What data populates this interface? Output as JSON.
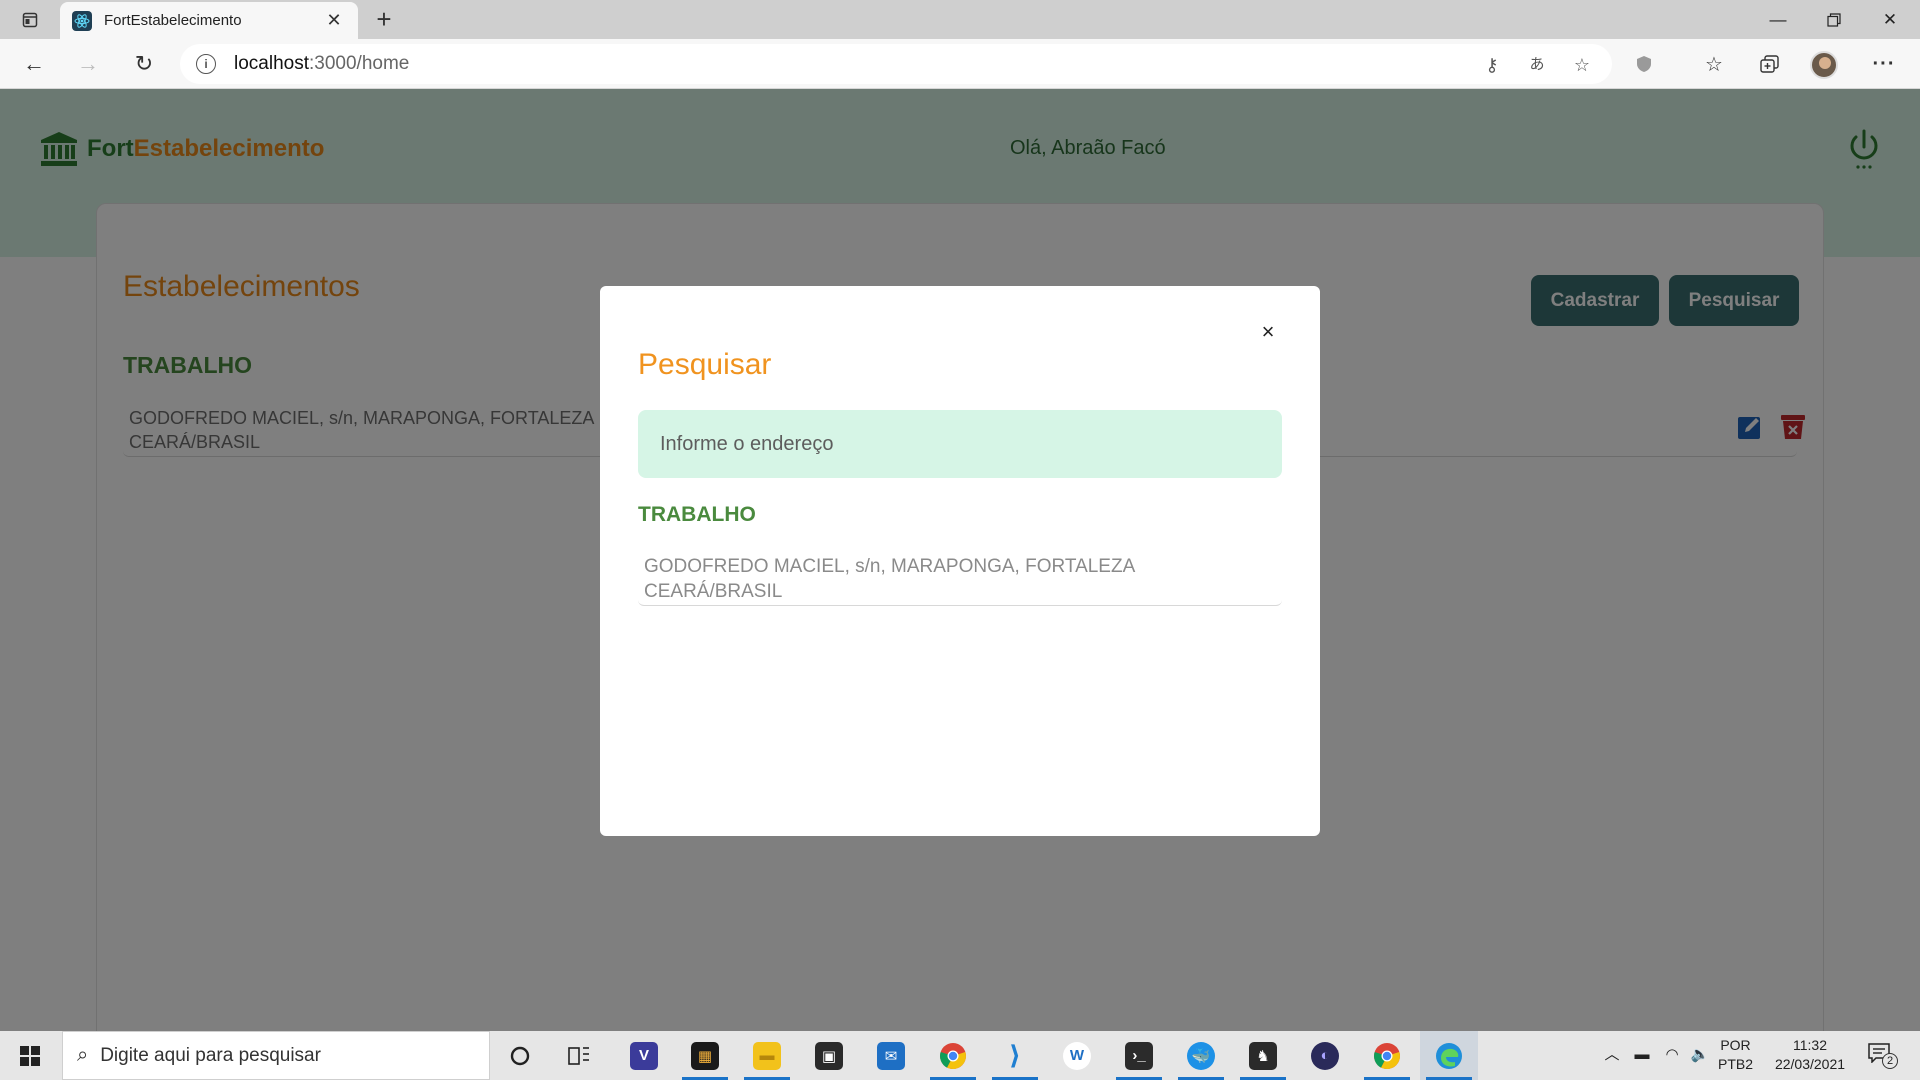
{
  "browser": {
    "tab_title": "FortEstabelecimento",
    "url_host": "localhost",
    "url_path": ":3000/home"
  },
  "app": {
    "logo_fort": "Fort",
    "logo_est": "Estabelecimento",
    "greeting": "Olá, Abraão Facó",
    "colors": {
      "header_bg": "#d6f2e4",
      "orange": "#e8891a",
      "green": "#4a8a3e",
      "button": "#3a6f70"
    }
  },
  "main": {
    "title": "Estabelecimentos",
    "cadastrar_label": "Cadastrar",
    "pesquisar_label": "Pesquisar",
    "groups": [
      {
        "title": "TRABALHO",
        "items": [
          {
            "line1": "GODOFREDO MACIEL, s/n, MARAPONGA, FORTALEZA",
            "line2": "CEARÁ/BRASIL"
          }
        ]
      }
    ]
  },
  "modal": {
    "title": "Pesquisar",
    "close_label": "×",
    "search_placeholder": "Informe o endereço",
    "group_title": "TRABALHO",
    "item_line1": "GODOFREDO MACIEL, s/n, MARAPONGA, FORTALEZA",
    "item_line2": "CEARÁ/BRASIL"
  },
  "taskbar": {
    "search_placeholder": "Digite aqui para pesquisar",
    "lang_line1": "POR",
    "lang_line2": "PTB2",
    "time": "11:32",
    "date": "22/03/2021",
    "notification_count": "2",
    "apps": [
      "cortana",
      "task-view",
      "visual-studio",
      "terminal-app",
      "file-explorer",
      "store",
      "mail",
      "chrome",
      "vscode",
      "app",
      "terminal",
      "docker",
      "insomnia",
      "app",
      "chrome",
      "edge"
    ]
  }
}
